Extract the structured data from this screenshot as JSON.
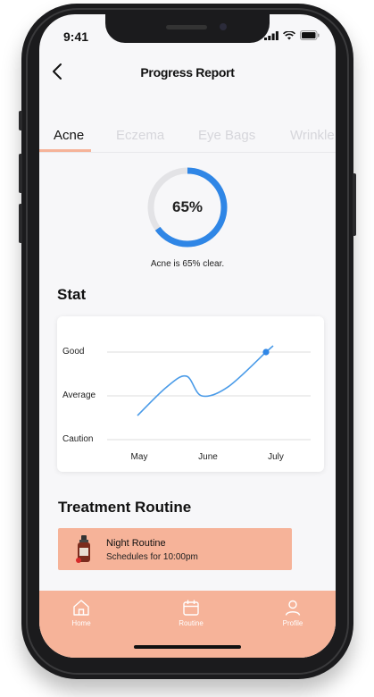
{
  "status_bar": {
    "time": "9:41"
  },
  "header": {
    "title": "Progress Report"
  },
  "tabs": [
    {
      "label": "Acne",
      "active": true
    },
    {
      "label": "Eczema",
      "active": false
    },
    {
      "label": "Eye Bags",
      "active": false
    },
    {
      "label": "Wrinkle",
      "active": false
    }
  ],
  "progress": {
    "value_text": "65%",
    "value": 0.65,
    "caption": "Acne is 65% clear."
  },
  "stat": {
    "heading": "Stat"
  },
  "chart_data": {
    "type": "line",
    "title": "",
    "xlabel": "",
    "ylabel": "",
    "categories": [
      "May",
      "June",
      "July"
    ],
    "y_levels": [
      "Caution",
      "Average",
      "Good"
    ],
    "ylim": [
      0,
      2
    ],
    "series": [
      {
        "x": [
          "May",
          "",
          "",
          "June",
          "",
          "July"
        ],
        "y": [
          0.55,
          1.2,
          1.45,
          1.0,
          1.2,
          2.0
        ],
        "highlight_last": true
      }
    ],
    "grid": true,
    "colors": {
      "line": "#4a9be8",
      "grid": "#dcdcdc"
    }
  },
  "treatment": {
    "heading": "Treatment Routine",
    "routine": {
      "title": "Night Routine",
      "subtitle": "Schedules for 10:00pm"
    }
  },
  "bottom_nav": [
    {
      "label": "Home",
      "icon": "home-icon"
    },
    {
      "label": "Routine",
      "icon": "calendar-icon"
    },
    {
      "label": "Profile",
      "icon": "profile-icon"
    }
  ],
  "colors": {
    "accent": "#f6b399",
    "progress": "#2f86e6",
    "track": "#e3e3e6"
  }
}
